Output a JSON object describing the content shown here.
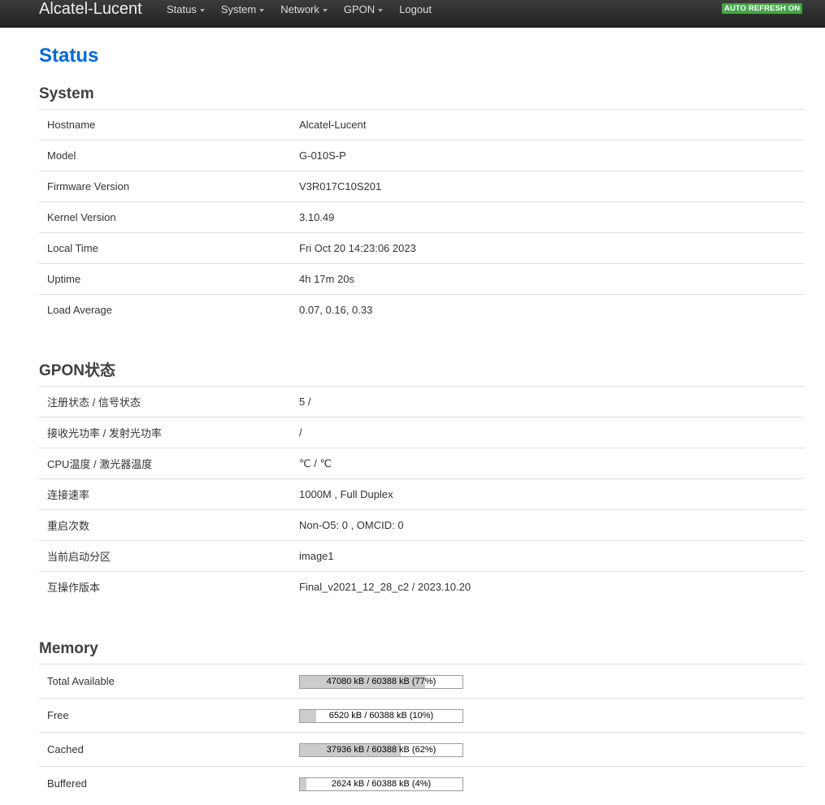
{
  "navbar": {
    "brand": "Alcatel-Lucent",
    "menu": [
      {
        "label": "Status",
        "dropdown": true
      },
      {
        "label": "System",
        "dropdown": true
      },
      {
        "label": "Network",
        "dropdown": true
      },
      {
        "label": "GPON",
        "dropdown": true
      },
      {
        "label": "Logout",
        "dropdown": false
      }
    ],
    "badge": "AUTO REFRESH ON",
    "badge_color": "#46a546"
  },
  "page": {
    "title": "Status",
    "title_color": "#0069d6"
  },
  "system": {
    "title": "System",
    "rows": [
      {
        "label": "Hostname",
        "value": "Alcatel-Lucent"
      },
      {
        "label": "Model",
        "value": "G-010S-P"
      },
      {
        "label": "Firmware Version",
        "value": "V3R017C10S201"
      },
      {
        "label": "Kernel Version",
        "value": "3.10.49"
      },
      {
        "label": "Local Time",
        "value": "Fri Oct 20 14:23:06 2023"
      },
      {
        "label": "Uptime",
        "value": "4h 17m 20s"
      },
      {
        "label": "Load Average",
        "value": "0.07, 0.16, 0.33"
      }
    ]
  },
  "gpon": {
    "title": "GPON状态",
    "rows": [
      {
        "label": "注册状态 / 信号状态",
        "value": "5 /"
      },
      {
        "label": "接收光功率 / 发射光功率",
        "value": "/"
      },
      {
        "label": "CPU温度 / 激光器温度",
        "value": "℃ / ℃"
      },
      {
        "label": "连接速率",
        "value": "1000M , Full Duplex"
      },
      {
        "label": "重启次数",
        "value": "Non-O5: 0 , OMCID: 0"
      },
      {
        "label": "当前启动分区",
        "value": "image1"
      },
      {
        "label": "互操作版本",
        "value": "Final_v2021_12_28_c2 / 2023.10.20"
      }
    ]
  },
  "memory": {
    "title": "Memory",
    "rows": [
      {
        "label": "Total Available",
        "text": "47080 kB / 60388 kB (77%)",
        "percent": 77
      },
      {
        "label": "Free",
        "text": "6520 kB / 60388 kB (10%)",
        "percent": 10
      },
      {
        "label": "Cached",
        "text": "37936 kB / 60388 kB (62%)",
        "percent": 62
      },
      {
        "label": "Buffered",
        "text": "2624 kB / 60388 kB (4%)",
        "percent": 4
      }
    ]
  }
}
